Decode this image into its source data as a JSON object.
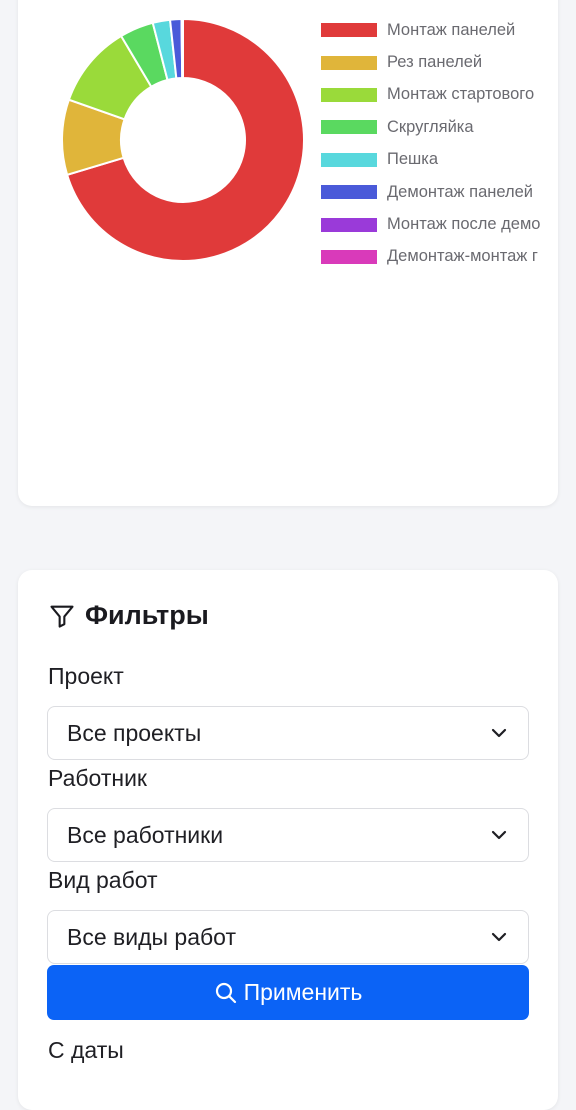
{
  "chart_data": {
    "type": "pie",
    "donut": true,
    "legend_position": "right",
    "categories": [
      "Монтаж панелей",
      "Рез панелей",
      "Монтаж стартового",
      "Скругляйка",
      "Пешка",
      "Демонтаж панелей",
      "Монтаж после демо",
      "Демонтаж-монтаж г"
    ],
    "values": [
      70,
      10,
      11,
      4.5,
      2.3,
      1.5,
      0.1,
      0.1
    ],
    "colors": [
      "#e03a3a",
      "#e0b53a",
      "#9ada3a",
      "#5ad960",
      "#58d8dd",
      "#4a5ad9",
      "#9a3ad9",
      "#d93aba"
    ]
  },
  "filters": {
    "title": "Фильтры",
    "project": {
      "label": "Проект",
      "value": "Все проекты"
    },
    "worker": {
      "label": "Работник",
      "value": "Все работники"
    },
    "work_type": {
      "label": "Вид работ",
      "value": "Все виды работ"
    },
    "apply_label": "Применить",
    "date_from_label": "С даты"
  },
  "icons": {
    "title_icon": "filter-icon",
    "select_icon": "chevron-down-icon",
    "apply_icon": "search-icon"
  }
}
